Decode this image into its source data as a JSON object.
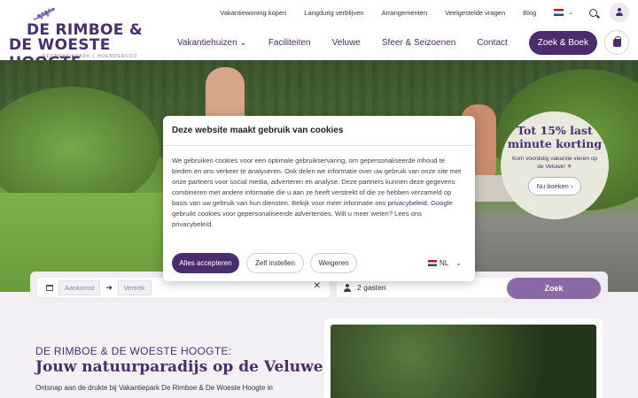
{
  "logo": {
    "line1": "DE RIMBOE &",
    "line2": "DE WOESTE HOOGTE",
    "tagline": "RECREATIEPARK | HOENDERLOO"
  },
  "topnav": [
    "Vakantiewoning kopen",
    "Langdurig verblijven",
    "Arrangementen",
    "Veelgestelde vragen",
    "Blog"
  ],
  "mainnav": {
    "items": [
      "Vakantiehuizen",
      "Faciliteiten",
      "Veluwe",
      "Sfeer & Seizoenen",
      "Contact"
    ],
    "book_label": "Zoek & Boek"
  },
  "promo": {
    "title": "Tot 15% last minute korting",
    "subtitle": "Kom voordelig vakantie vieren op de Veluwe! ☀",
    "button": "Nu boeken"
  },
  "search": {
    "arrival_placeholder": "Aankomst",
    "departure_placeholder": "Vertrek",
    "guests": "2 gasten",
    "submit": "Zoek"
  },
  "content": {
    "kicker": "DE RIMBOE & DE WOESTE HOOGTE:",
    "headline": "Jouw natuurparadijs op de Veluwe",
    "intro": "Ontsnap aan de drukte bij Vakantiepark De Rimboe & De Woeste Hoogte in"
  },
  "cookie": {
    "title": "Deze website maakt gebruik van cookies",
    "body_part1": "We gebruiken cookies voor een optimale gebruikservaring, om gepersonaliseerde inhoud te bieden en ons verkeer te analyseren. Ook delen we informatie over uw gebruik van onze site met onze partners voor social media, adverteren en analyse. Deze partners kunnen deze gegevens combineren met andere informatie die u aan ze heeft verstrekt of die ze hebben verzameld op basis van uw gebruik van hun diensten. Bekijk voor meer informatie ons ",
    "privacy_link": "privacybeleid",
    "body_part2": ". ",
    "google_link": "Google",
    "body_part3": " gebruikt cookies voor gepersonaliseerde advertenties. Wilt u meer weten? Lees ons privacybeleid.",
    "accept": "Alles accepteren",
    "customize": "Zelf instellen",
    "deny": "Weigeren",
    "language": "NL"
  },
  "colors": {
    "brand": "#4b2d6f",
    "search_button": "#8a6aa6",
    "promo_bg": "#e9e8dc"
  },
  "icons": [
    "sprig-logo-icon",
    "chevron-down-icon",
    "flag-nl-icon",
    "search-icon",
    "user-icon",
    "bag-icon",
    "calendar-icon",
    "arrow-right-icon",
    "close-icon",
    "person-icon",
    "chevron-right-icon"
  ]
}
